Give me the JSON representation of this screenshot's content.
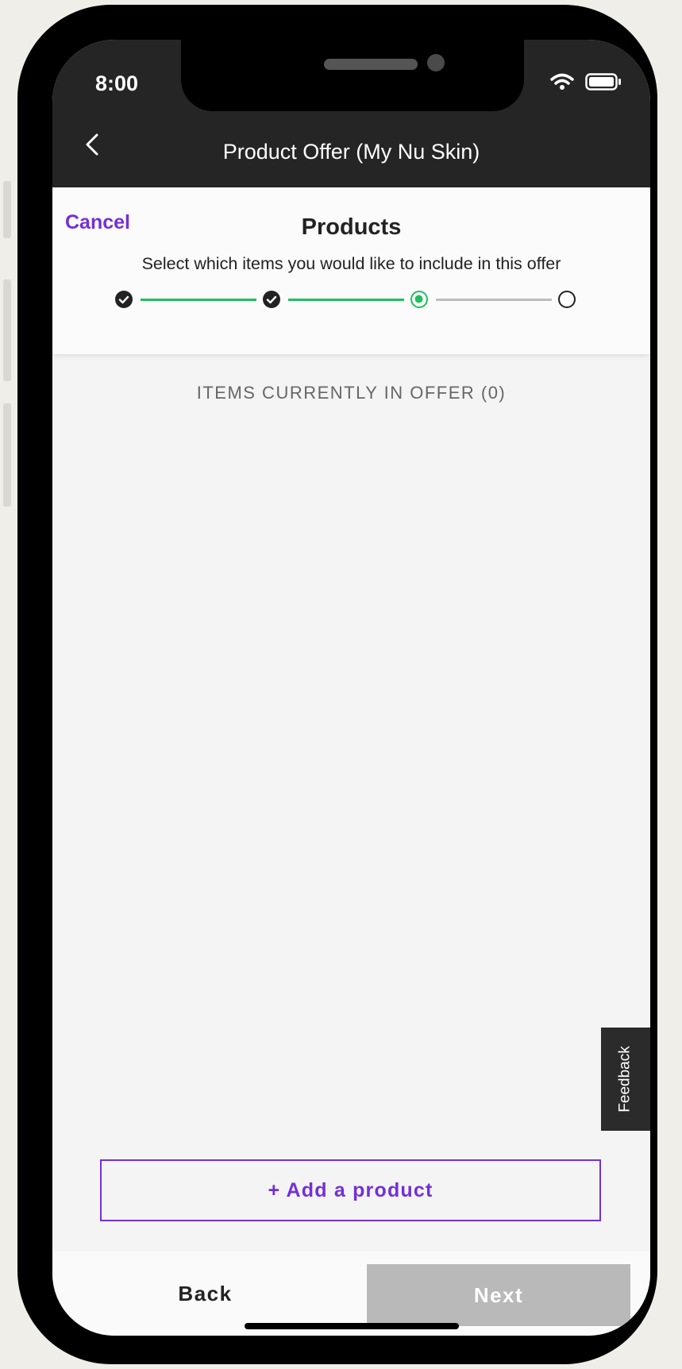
{
  "status_bar": {
    "time": "8:00"
  },
  "nav": {
    "title": "Product Offer (My Nu Skin)"
  },
  "header": {
    "cancel_label": "Cancel",
    "title": "Products",
    "subtitle": "Select which items you would like to include in this offer"
  },
  "stepper": {
    "steps": [
      "completed",
      "completed",
      "current",
      "pending"
    ],
    "active_color": "#1fc05d",
    "pending_color": "#bdbdbd"
  },
  "items": {
    "label": "ITEMS CURRENTLY IN OFFER (0)"
  },
  "feedback_label": "Feedback",
  "add_product_label": "+ Add a product",
  "footer": {
    "back_label": "Back",
    "next_label": "Next"
  },
  "colors": {
    "accent": "#7330d8",
    "nav_bg": "#252525",
    "page_bg": "#f4f4f4",
    "disabled": "#b8b9b8"
  }
}
